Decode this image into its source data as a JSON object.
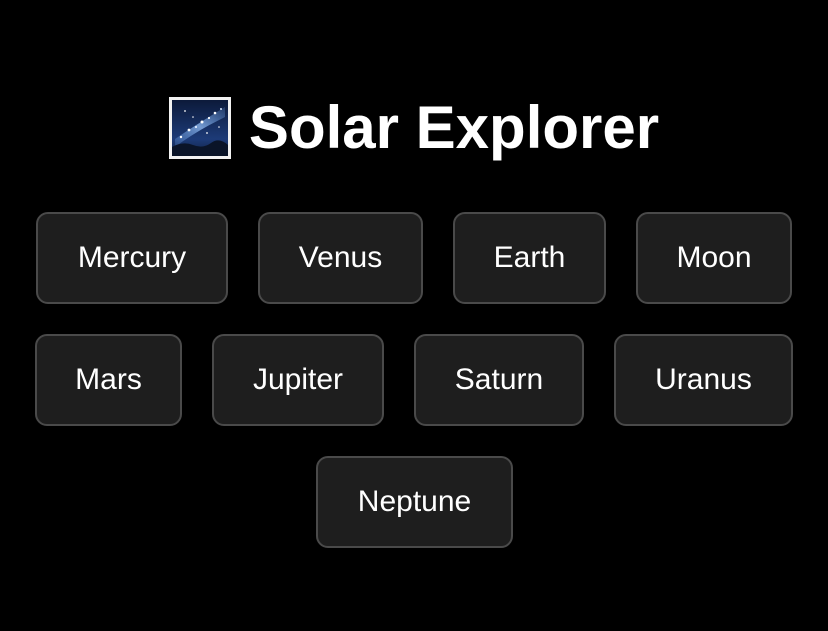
{
  "header": {
    "title": "Solar Explorer",
    "icon": "milky-way-icon"
  },
  "planets": [
    {
      "label": "Mercury"
    },
    {
      "label": "Venus"
    },
    {
      "label": "Earth"
    },
    {
      "label": "Moon"
    },
    {
      "label": "Mars"
    },
    {
      "label": "Jupiter"
    },
    {
      "label": "Saturn"
    },
    {
      "label": "Uranus"
    },
    {
      "label": "Neptune"
    }
  ],
  "colors": {
    "background": "#000000",
    "button_bg": "#1e1e1e",
    "button_border": "#4a4a4a",
    "text": "#ffffff"
  }
}
